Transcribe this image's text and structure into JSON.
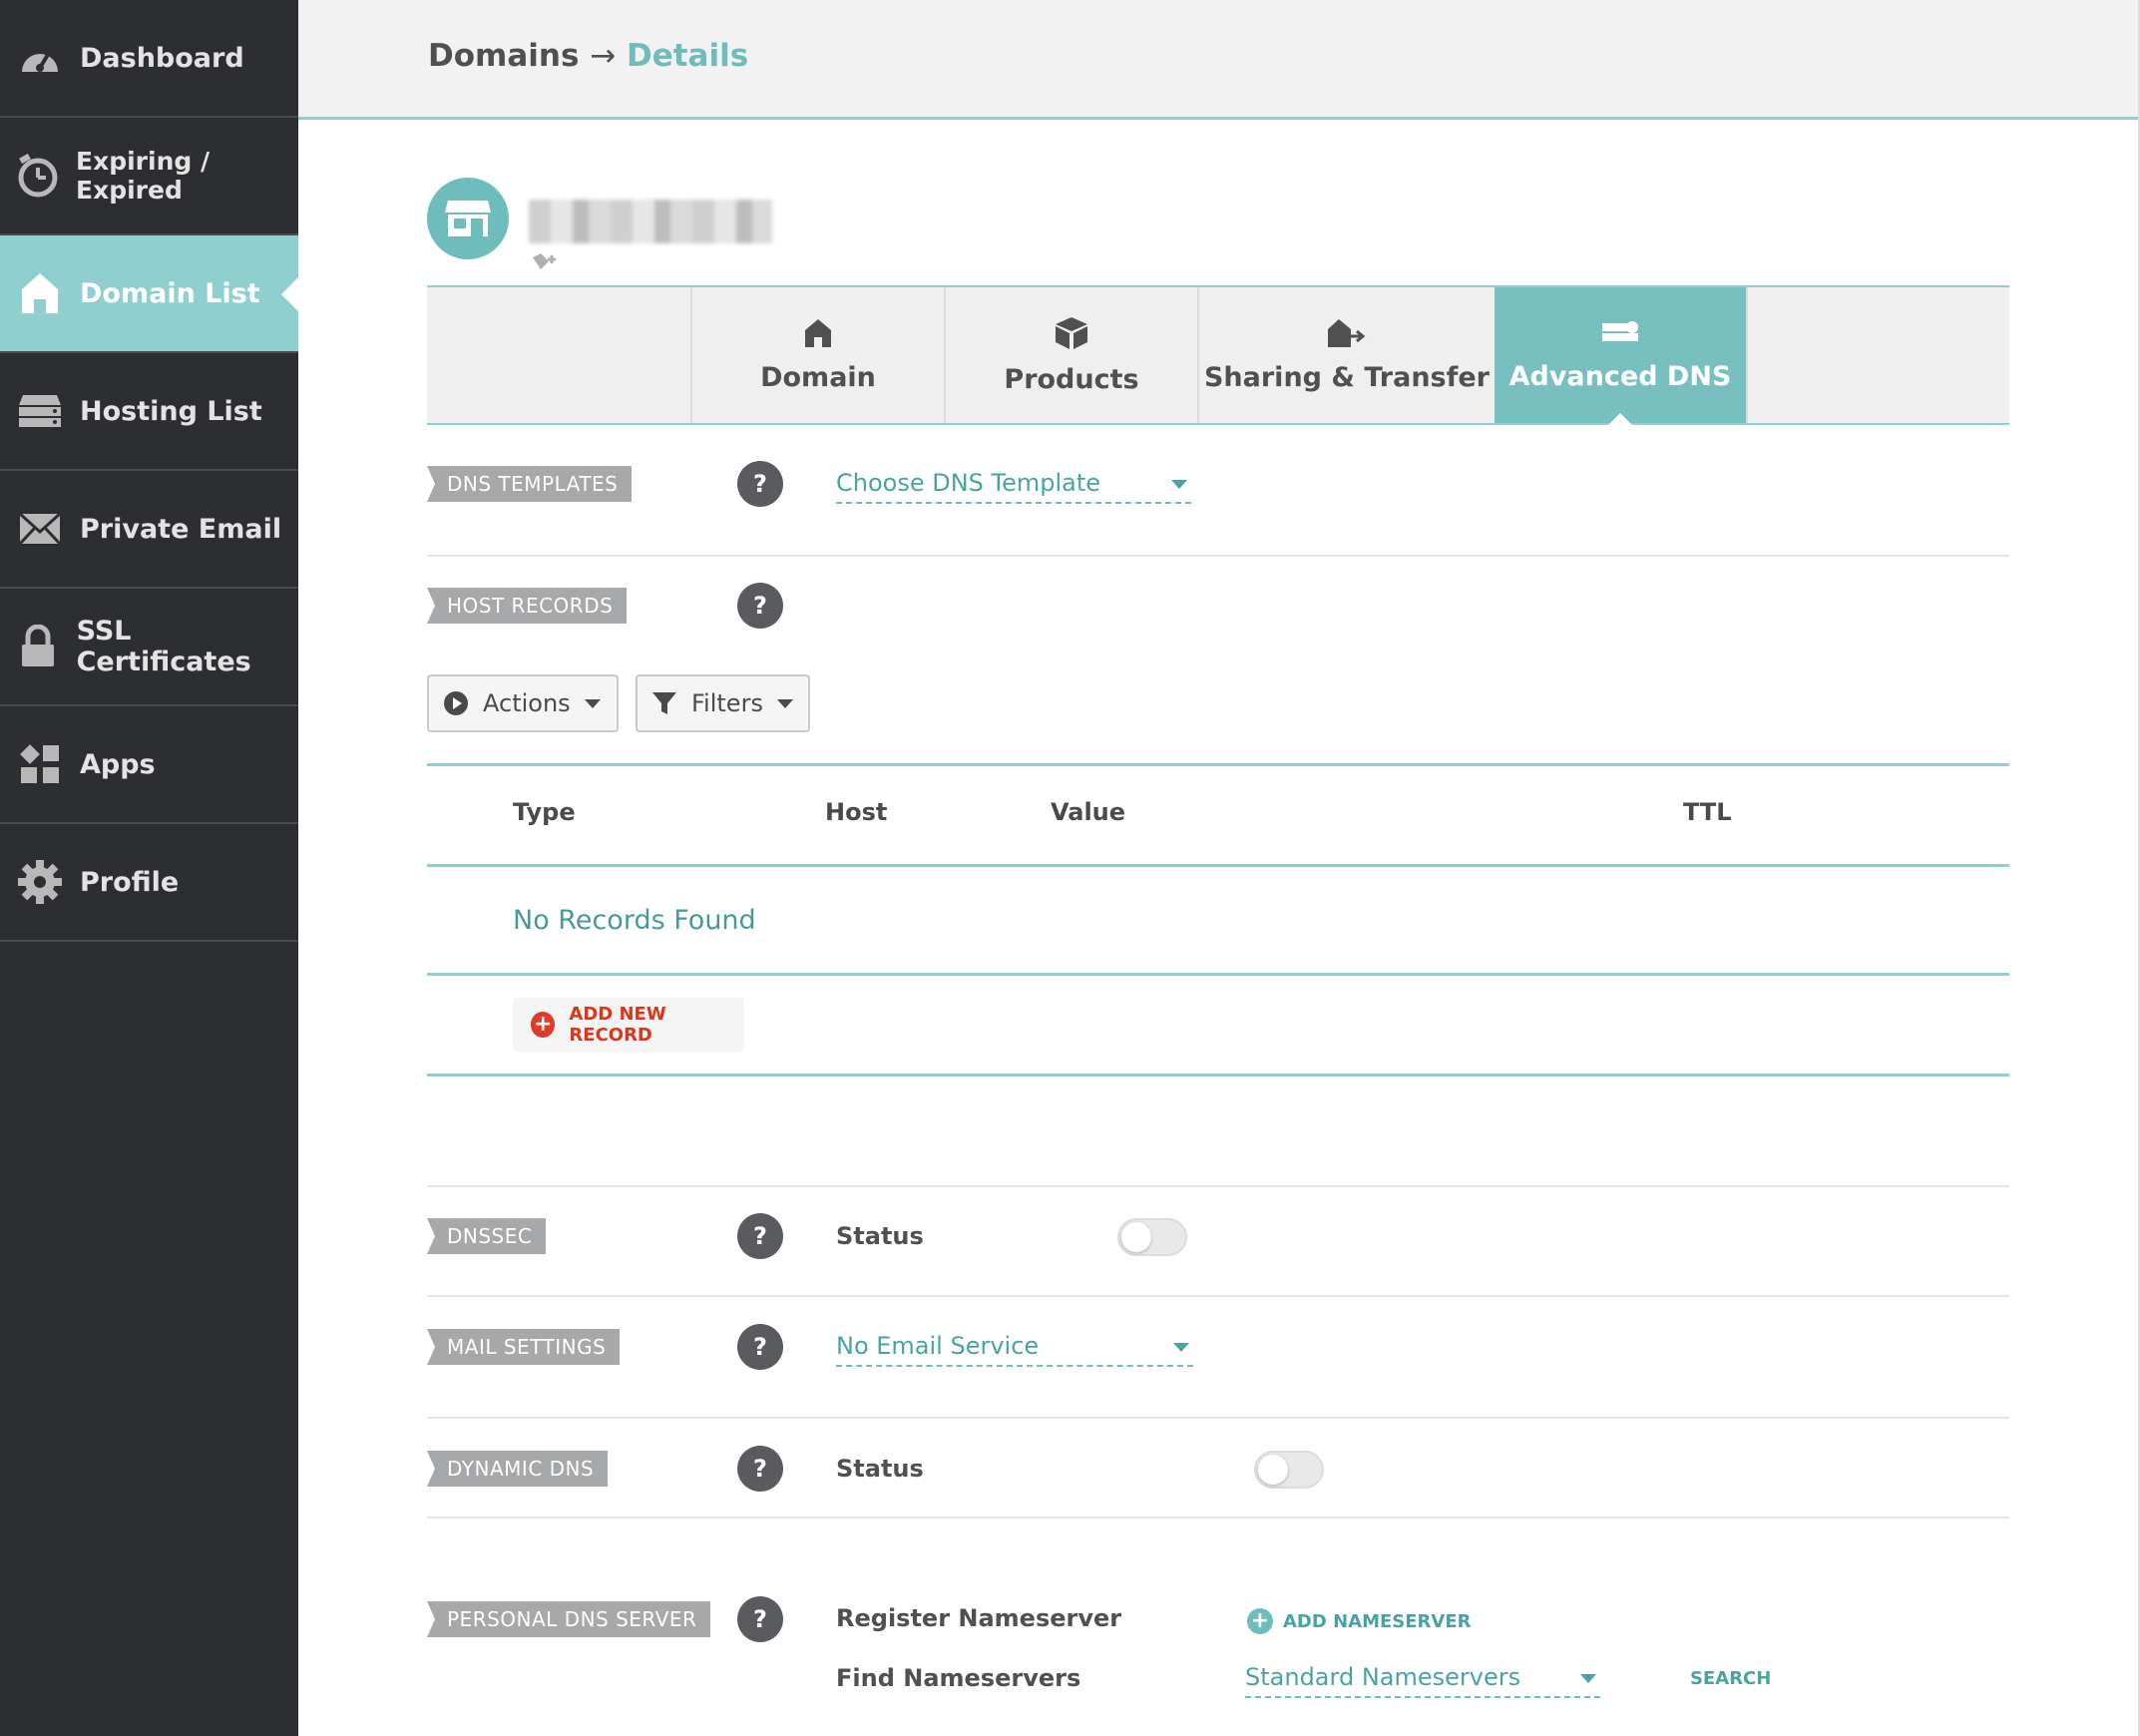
{
  "sidebar": {
    "items": [
      {
        "label": "Dashboard",
        "icon": "speedometer-icon",
        "active": false
      },
      {
        "label": "Expiring / Expired",
        "icon": "timer-icon",
        "active": false
      },
      {
        "label": "Domain List",
        "icon": "home-icon",
        "active": true
      },
      {
        "label": "Hosting List",
        "icon": "server-icon",
        "active": false
      },
      {
        "label": "Private Email",
        "icon": "envelope-icon",
        "active": false
      },
      {
        "label": "SSL Certificates",
        "icon": "lock-icon",
        "active": false
      },
      {
        "label": "Apps",
        "icon": "apps-grid-icon",
        "active": false
      },
      {
        "label": "Profile",
        "icon": "gear-icon",
        "active": false
      }
    ]
  },
  "header": {
    "breadcrumb_root": "Domains",
    "breadcrumb_arrow": "→",
    "breadcrumb_current": "Details"
  },
  "tabs": [
    {
      "label": "Domain",
      "icon": "home-icon",
      "active": false
    },
    {
      "label": "Products",
      "icon": "box-icon",
      "active": false
    },
    {
      "label": "Sharing & Transfer",
      "icon": "house-arrow-icon",
      "active": false
    },
    {
      "label": "Advanced DNS",
      "icon": "dns-server-icon",
      "active": true
    }
  ],
  "sections": {
    "dns_templates": {
      "label": "DNS TEMPLATES",
      "help": "?",
      "dropdown": "Choose DNS Template"
    },
    "host_records": {
      "label": "HOST RECORDS",
      "help": "?"
    },
    "dnssec": {
      "label": "DNSSEC",
      "help": "?",
      "status_label": "Status",
      "status_on": false
    },
    "mail_settings": {
      "label": "MAIL SETTINGS",
      "help": "?",
      "dropdown": "No Email Service"
    },
    "dynamic_dns": {
      "label": "DYNAMIC DNS",
      "help": "?",
      "status_label": "Status",
      "status_on": false
    },
    "personal_dns": {
      "label": "PERSONAL DNS SERVER",
      "help": "?",
      "register_label": "Register Nameserver",
      "add_nameserver": "ADD NAMESERVER",
      "find_label": "Find Nameservers",
      "find_dropdown": "Standard Nameservers",
      "search": "SEARCH"
    }
  },
  "toolbar": {
    "actions": "Actions",
    "filters": "Filters"
  },
  "table": {
    "columns": [
      "Type",
      "Host",
      "Value",
      "TTL"
    ],
    "empty": "No Records Found",
    "add_record": "ADD NEW RECORD"
  },
  "colors": {
    "accent": "#8fcfcf",
    "sidebar": "#2d2e32",
    "danger": "#e03a2a"
  }
}
